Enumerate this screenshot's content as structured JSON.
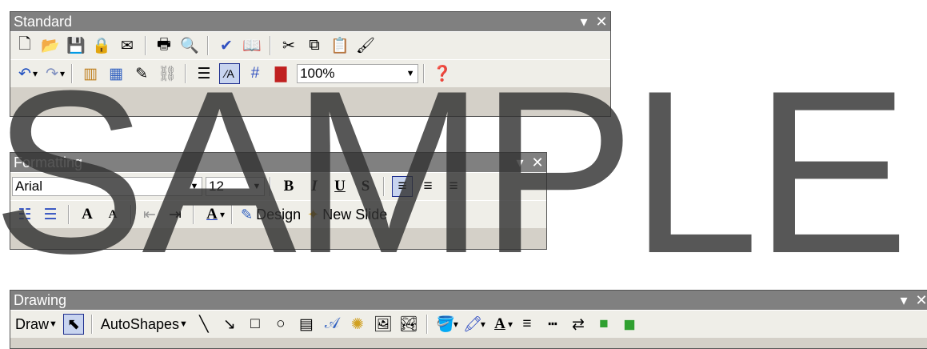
{
  "standard": {
    "title": "Standard",
    "row1": [
      "new-icon",
      "open-icon",
      "save-icon",
      "permission-icon",
      "email-icon",
      "print-icon",
      "print-preview-icon",
      "spelling-icon",
      "research-icon",
      "cut-icon",
      "copy-icon",
      "paste-icon",
      "format-painter-icon"
    ],
    "row2_icons": [
      "undo-icon",
      "redo-icon",
      "chart-icon",
      "table-icon",
      "tables-borders-icon",
      "hyperlink-icon",
      "expand-icon",
      "show-formatting-icon",
      "grid-icon",
      "color-icon",
      "help-icon"
    ],
    "zoom": "100%"
  },
  "formatting": {
    "title": "Formatting",
    "font": "Arial",
    "size": "12",
    "bold": "B",
    "italic": "I",
    "underline": "U",
    "shadow": "S",
    "font_color_label": "A",
    "design": "Design",
    "new_slide": "New Slide"
  },
  "drawing": {
    "title": "Drawing",
    "draw": "Draw",
    "autoshapes": "AutoShapes"
  },
  "watermark": "SAMPLE"
}
